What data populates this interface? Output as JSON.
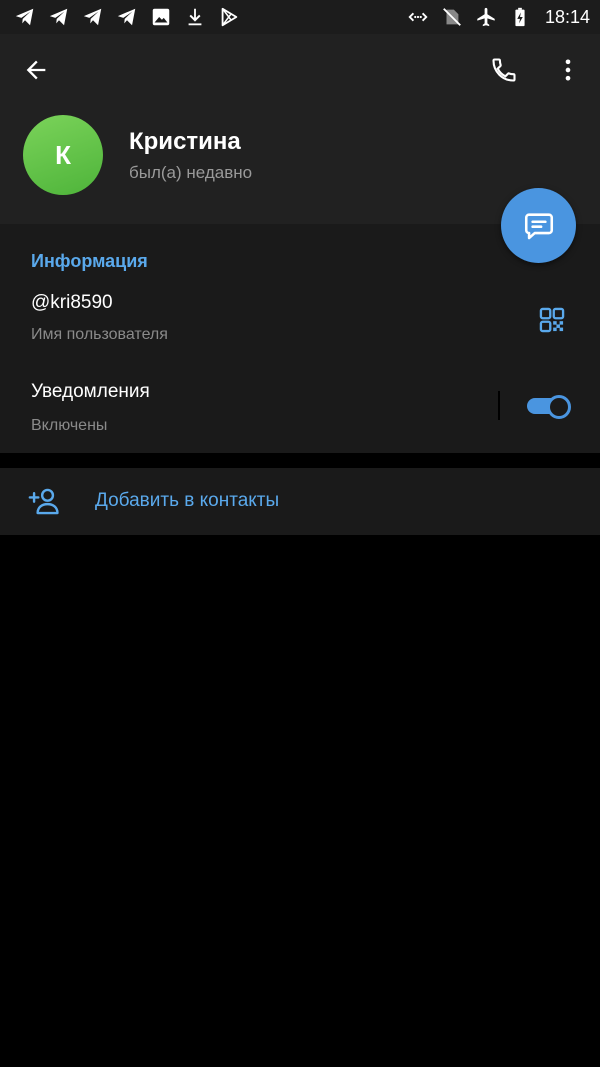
{
  "status_bar": {
    "time": "18:14",
    "left_icons": [
      "telegram-icon",
      "telegram-icon",
      "telegram-icon",
      "telegram-icon",
      "image-icon",
      "download-icon",
      "play-store-icon"
    ],
    "right_icons": [
      "data-saver-icon",
      "no-sim-icon",
      "airplane-icon",
      "battery-charging-icon"
    ]
  },
  "header": {
    "back_icon": "arrow-left-icon",
    "call_icon": "phone-icon",
    "more_icon": "more-vertical-icon"
  },
  "profile": {
    "avatar_letter": "К",
    "name": "Кристина",
    "status": "был(а) недавно",
    "avatar_color": "#5fc046"
  },
  "fab": {
    "icon": "message-icon",
    "color": "#4a95e0"
  },
  "info": {
    "title": "Информация",
    "username": "@kri8590",
    "username_caption": "Имя пользователя",
    "qr_icon": "qr-code-icon",
    "notifications_label": "Уведомления",
    "notifications_status": "Включены",
    "notifications_enabled": true
  },
  "add_contact": {
    "icon": "add-user-icon",
    "label": "Добавить в контакты"
  },
  "colors": {
    "accent": "#5aa9ec",
    "header_bg": "#212121",
    "section_bg": "#1a1a1a",
    "background": "#000000"
  }
}
